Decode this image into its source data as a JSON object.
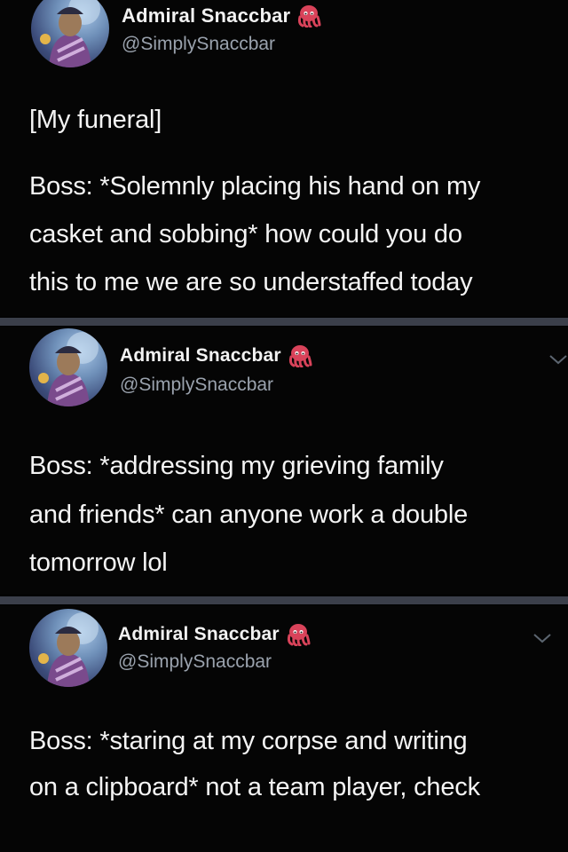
{
  "colors": {
    "background": "#000000",
    "divider": "#3b3f4a",
    "name": "#f2f2f2",
    "handle": "#9aa2ad",
    "body_text": "#f4f4f4"
  },
  "tweets": [
    {
      "avatar_icon": "avatar-icon",
      "display_name": "Admiral Snaccbar",
      "name_emoji_icon": "octopus-emoji-icon",
      "handle": "@SimplySnaccbar",
      "text_lines": [
        "[My funeral]",
        "",
        "Boss: *Solemnly placing his hand on my",
        "casket and sobbing* how could you do",
        "this to me we are so understaffed today"
      ]
    },
    {
      "avatar_icon": "avatar-icon",
      "display_name": "Admiral Snaccbar",
      "name_emoji_icon": "octopus-emoji-icon",
      "handle": "@SimplySnaccbar",
      "menu_icon": "chevron-down-icon",
      "text_lines": [
        "Boss: *addressing my grieving family",
        "and friends* can anyone work a double",
        "tomorrow lol"
      ]
    },
    {
      "avatar_icon": "avatar-icon",
      "display_name": "Admiral Snaccbar",
      "name_emoji_icon": "octopus-emoji-icon",
      "handle": "@SimplySnaccbar",
      "menu_icon": "chevron-down-icon",
      "text_lines": [
        "Boss: *staring at my corpse and writing",
        "on a clipboard* not a team player, check"
      ]
    }
  ]
}
